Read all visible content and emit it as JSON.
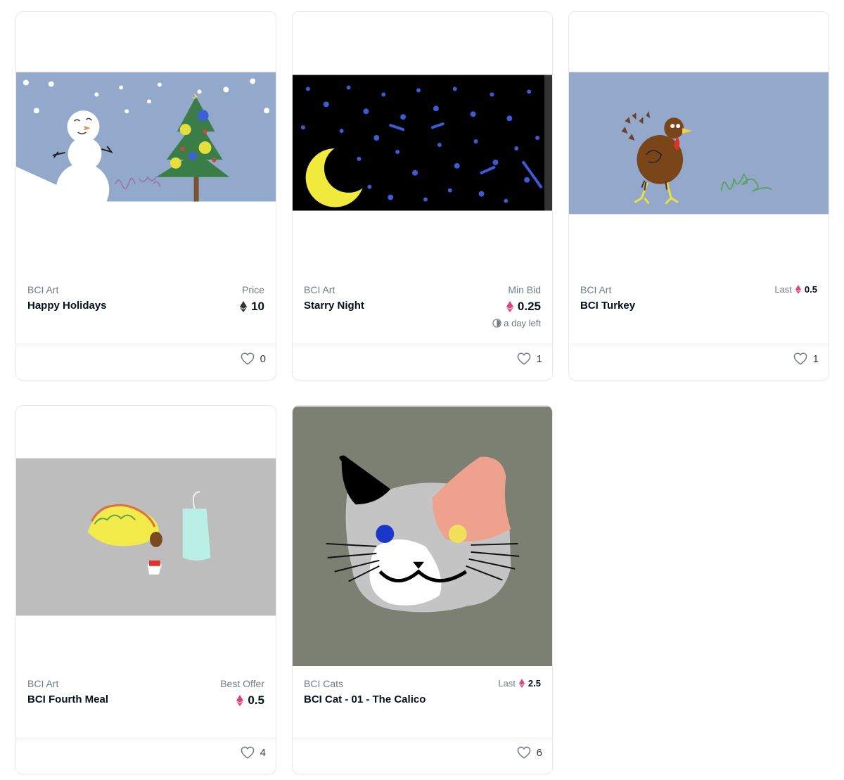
{
  "colors": {
    "eth_black": "#343434",
    "eth_pink": "#e0447e",
    "border": "#e5e8eb"
  },
  "cards": [
    {
      "collection": "BCI Art",
      "title": "Happy Holidays",
      "price_label": "Price",
      "price": "10",
      "eth_icon": "eth-black-icon",
      "likes": "0"
    },
    {
      "collection": "BCI Art",
      "title": "Starry Night",
      "price_label": "Min Bid",
      "price": "0.25",
      "eth_icon": "eth-pink-icon",
      "time_left": "a day left",
      "likes": "1"
    },
    {
      "collection": "BCI Art",
      "title": "BCI Turkey",
      "last_label": "Last",
      "last_price": "0.5",
      "eth_icon": "eth-pink-icon",
      "likes": "1"
    },
    {
      "collection": "BCI Art",
      "title": "BCI Fourth Meal",
      "price_label": "Best Offer",
      "price": "0.5",
      "eth_icon": "eth-pink-icon",
      "likes": "4"
    },
    {
      "collection": "BCI Cats",
      "title": "BCI Cat - 01 - The Calico",
      "last_label": "Last",
      "last_price": "2.5",
      "eth_icon": "eth-pink-icon",
      "likes": "6"
    }
  ]
}
